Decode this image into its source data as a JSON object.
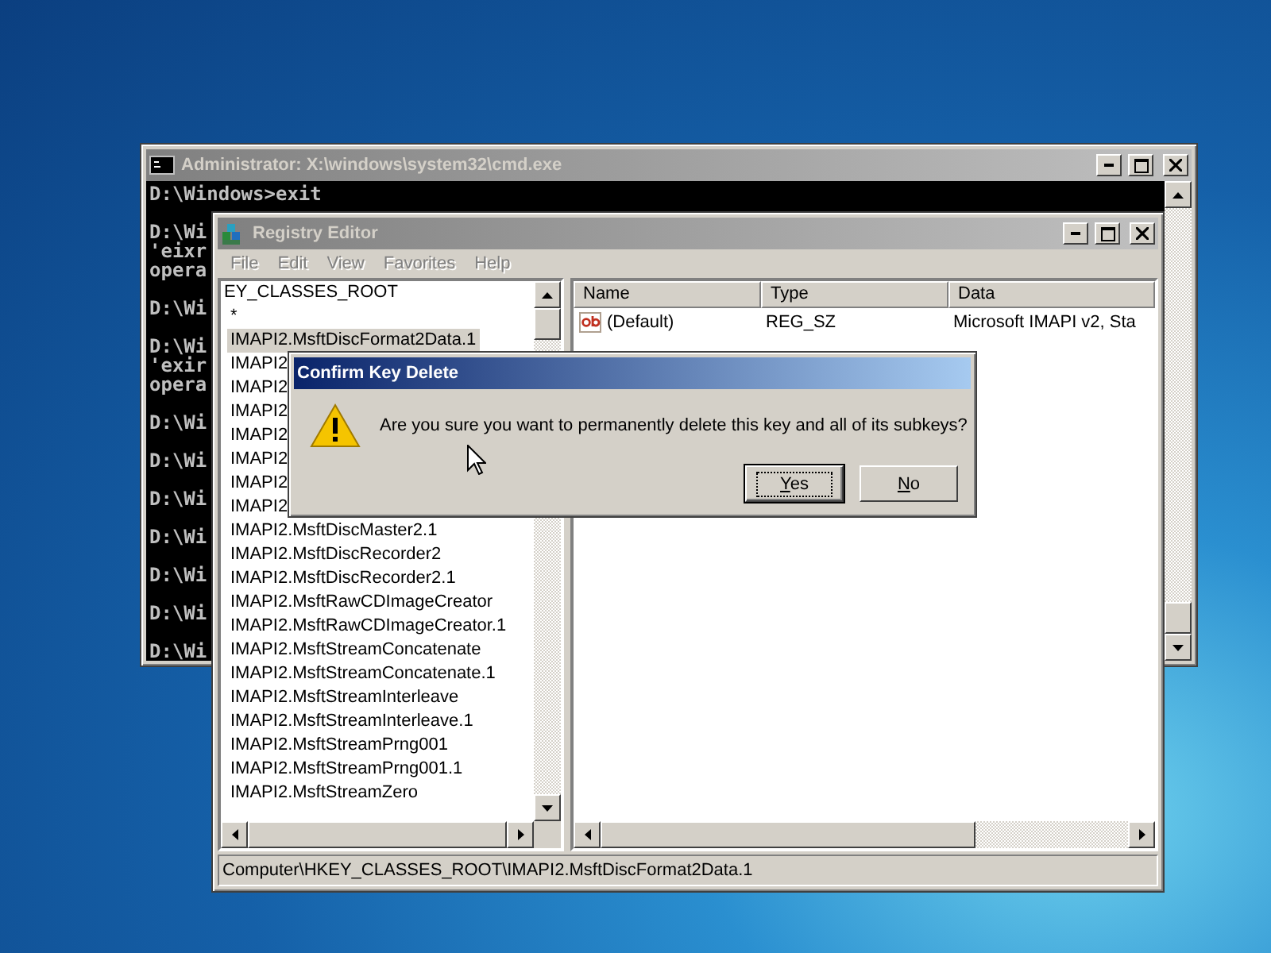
{
  "cmd": {
    "title": "Administrator: X:\\windows\\system32\\cmd.exe",
    "blocks": [
      [
        "D:\\Windows>exit"
      ],
      [
        "D:\\Wi",
        "'eixr",
        "opera"
      ],
      [
        "D:\\Wi"
      ],
      [
        "D:\\Wi",
        "'exir",
        "opera"
      ],
      [
        "D:\\Wi"
      ],
      [
        "D:\\Wi"
      ],
      [
        "D:\\Wi"
      ],
      [
        "D:\\Wi"
      ],
      [
        "D:\\Wi"
      ],
      [
        "D:\\Wi"
      ],
      [
        "D:\\Wi"
      ]
    ]
  },
  "regedit": {
    "title": "Registry Editor",
    "menu": [
      {
        "label": "File",
        "disabled": true
      },
      {
        "label": "Edit",
        "disabled": true
      },
      {
        "label": "View",
        "disabled": true
      },
      {
        "label": "Favorites",
        "disabled": true
      },
      {
        "label": "Help",
        "disabled": true
      }
    ],
    "tree": {
      "label": "EY_CLASSES_ROOT",
      "children": [
        {
          "label": "*",
          "selected": false
        },
        {
          "label": "IMAPI2.MsftDiscFormat2Data.1",
          "selected": true
        },
        {
          "label": "IMAPI2",
          "selected": false
        },
        {
          "label": "IMAPI2",
          "selected": false
        },
        {
          "label": "IMAPI2",
          "selected": false
        },
        {
          "label": "IMAPI2",
          "selected": false
        },
        {
          "label": "IMAPI2",
          "selected": false
        },
        {
          "label": "IMAPI2",
          "selected": false
        },
        {
          "label": "IMAPI2",
          "selected": false
        },
        {
          "label": "IMAPI2.MsftDiscMaster2.1",
          "selected": false
        },
        {
          "label": "IMAPI2.MsftDiscRecorder2",
          "selected": false
        },
        {
          "label": "IMAPI2.MsftDiscRecorder2.1",
          "selected": false
        },
        {
          "label": "IMAPI2.MsftRawCDImageCreator",
          "selected": false
        },
        {
          "label": "IMAPI2.MsftRawCDImageCreator.1",
          "selected": false
        },
        {
          "label": "IMAPI2.MsftStreamConcatenate",
          "selected": false
        },
        {
          "label": "IMAPI2.MsftStreamConcatenate.1",
          "selected": false
        },
        {
          "label": "IMAPI2.MsftStreamInterleave",
          "selected": false
        },
        {
          "label": "IMAPI2.MsftStreamInterleave.1",
          "selected": false
        },
        {
          "label": "IMAPI2.MsftStreamPrng001",
          "selected": false
        },
        {
          "label": "IMAPI2.MsftStreamPrng001.1",
          "selected": false
        },
        {
          "label": "IMAPI2.MsftStreamZero",
          "selected": false
        }
      ]
    },
    "columns": [
      "Name",
      "Type",
      "Data"
    ],
    "rows": [
      {
        "name": "(Default)",
        "type": "REG_SZ",
        "data": "Microsoft IMAPI v2, Sta"
      }
    ],
    "status_bar": "Computer\\HKEY_CLASSES_ROOT\\IMAPI2.MsftDiscFormat2Data.1"
  },
  "dialog": {
    "title": "Confirm Key Delete",
    "message": "Are you sure you want to permanently delete this key and all of its subkeys?",
    "buttons": [
      {
        "label": "Yes",
        "default": true
      },
      {
        "label": "No",
        "default": false
      }
    ]
  }
}
